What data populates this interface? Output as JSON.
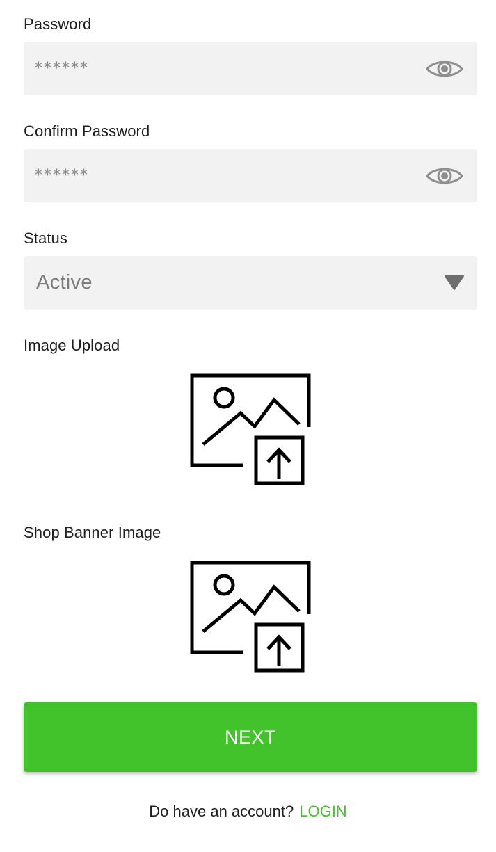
{
  "form": {
    "password": {
      "label": "Password",
      "value": "******",
      "toggle_icon": "eye-icon"
    },
    "confirm_password": {
      "label": "Confirm Password",
      "value": "******",
      "toggle_icon": "eye-icon"
    },
    "status": {
      "label": "Status",
      "selected": "Active",
      "icon": "caret-down-icon"
    },
    "image_upload": {
      "label": "Image Upload",
      "icon": "image-upload-icon"
    },
    "shop_banner": {
      "label": "Shop Banner Image",
      "icon": "image-upload-icon"
    }
  },
  "actions": {
    "next_label": "NEXT"
  },
  "footer": {
    "prompt": "Do have an account?",
    "login_label": "LOGIN"
  },
  "colors": {
    "accent": "#42c22b",
    "field_bg": "#f2f2f2",
    "placeholder": "#8a8a8a"
  }
}
